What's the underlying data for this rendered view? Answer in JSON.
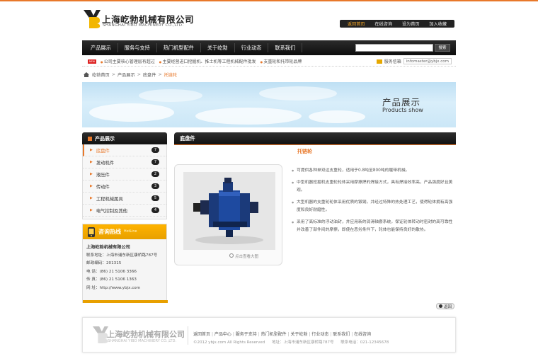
{
  "brand": {
    "name_cn": "上海屹勃机械有限公司",
    "name_en": "SHANGHAI YIBO MACHINERY CO.,LTD."
  },
  "toplinks": [
    "返回首页",
    "在线咨询",
    "设为首页",
    "加入收藏"
  ],
  "nav": {
    "items": [
      "产品展示",
      "服务与支持",
      "热门机型配件",
      "关于屹勃",
      "行业动态",
      "联系我们"
    ],
    "search_button": "搜索",
    "search_placeholder": ""
  },
  "news": {
    "badge": "NEW",
    "items": [
      "公司主要核心管理层有超过",
      "主要经营进口挖掘机、推土机等工程机械配件批发",
      "支重轮和托带轮品牌"
    ],
    "mail_label": "服务信箱",
    "mail_value": "infomaster@ybjx.com"
  },
  "breadcrumb": [
    "屹勃首页",
    "产品展示",
    "底盘件",
    "托链轮"
  ],
  "banner": {
    "title": "产品展示",
    "subtitle": "Products show"
  },
  "sidebar": {
    "title": "产品展示",
    "items": [
      {
        "label": "底盘件",
        "count": "7",
        "active": true
      },
      {
        "label": "发动机件",
        "count": "7",
        "active": false
      },
      {
        "label": "液压件",
        "count": "2",
        "active": false
      },
      {
        "label": "传动件",
        "count": "3",
        "active": false
      },
      {
        "label": "工程机械属具",
        "count": "5",
        "active": false
      },
      {
        "label": "电气控制及其他",
        "count": "4",
        "active": false
      }
    ]
  },
  "hotline": {
    "title": "咨询热线",
    "title_en": "HotLine",
    "company": "上海屹勃机械有限公司",
    "address": "联系地址：上海市浦东新区康桥路787号",
    "postcode": "邮政编码：201315",
    "phone": "电    话：(86) 21 5106 3366",
    "fax": "传    真：(86) 21 5106 1363",
    "website": "网    址：http://www.ybjx.com"
  },
  "main": {
    "section_title": "底盘件",
    "product_title": "托链轮",
    "zoom_label": "点击查看大图",
    "descriptions": [
      "可提供各种单双边支重轮，适用于0.8吨至800吨的履带机械。",
      "中型机器挖掘机支重轮轮体采用摩擦焊的焊接方式，具有焊接效率高，产品强度好且美观。",
      "大型机器的支重轮轮体采用优质的锻钢，并经过特殊的热处理工艺，使得轮体拥有高强度和良好耐磨性。",
      "采用了高标准的浮动油封，并应用新的润滑轴套系统，保证轮体转动时密封的高可靠性并改善了部件间的摩擦，即使在恶劣条件下，轮体也能保持良好的散热。"
    ],
    "back_label": "返回"
  },
  "footer": {
    "links": [
      "返回首页",
      "产品中心",
      "服务于支持",
      "热门机型配件",
      "关于屹勃",
      "行业动态",
      "联系我们",
      "在线咨询"
    ],
    "copyright": "©2012 ybjx.com  All Rights Reserved",
    "address": "地址：上海市浦东新区康桥路787号",
    "phone": "联系电话：021-12345678"
  },
  "colors": {
    "accent": "#e8782a",
    "hotline": "#f0a800",
    "nav_bg": "#1a1a1a"
  }
}
